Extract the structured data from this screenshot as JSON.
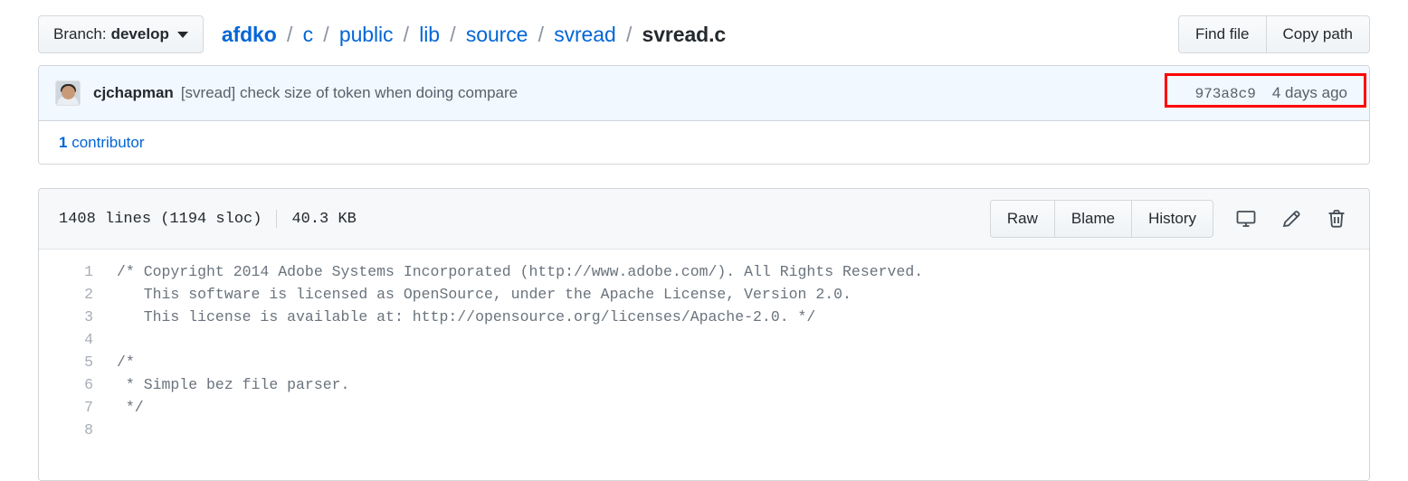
{
  "top_bar": {
    "branch_button": {
      "prefix": "Branch:",
      "name": "develop"
    },
    "breadcrumb": {
      "repo": "afdko",
      "segments": [
        "c",
        "public",
        "lib",
        "source",
        "svread"
      ],
      "file": "svread.c",
      "separator": "/"
    },
    "actions": {
      "find_file": "Find file",
      "copy_path": "Copy path"
    }
  },
  "commit": {
    "author": "cjchapman",
    "message": "[svread] check size of token when doing compare",
    "sha": "973a8c9",
    "date": "4 days ago",
    "highlight_color": "#fe0000",
    "contributors": {
      "count": "1",
      "label": " contributor"
    }
  },
  "file": {
    "lines_text": "1408 lines (1194 sloc)",
    "size_text": "40.3 KB",
    "buttons": [
      "Raw",
      "Blame",
      "History"
    ],
    "icons": [
      "desktop-icon",
      "pencil-icon",
      "trash-icon"
    ],
    "code": [
      {
        "number": "1",
        "text": "/* Copyright 2014 Adobe Systems Incorporated (http://www.adobe.com/). All Rights Reserved."
      },
      {
        "number": "2",
        "text": "   This software is licensed as OpenSource, under the Apache License, Version 2.0."
      },
      {
        "number": "3",
        "text": "   This license is available at: http://opensource.org/licenses/Apache-2.0. */"
      },
      {
        "number": "4",
        "text": ""
      },
      {
        "number": "5",
        "text": "/*"
      },
      {
        "number": "6",
        "text": " * Simple bez file parser."
      },
      {
        "number": "7",
        "text": " */"
      },
      {
        "number": "8",
        "text": ""
      }
    ]
  }
}
